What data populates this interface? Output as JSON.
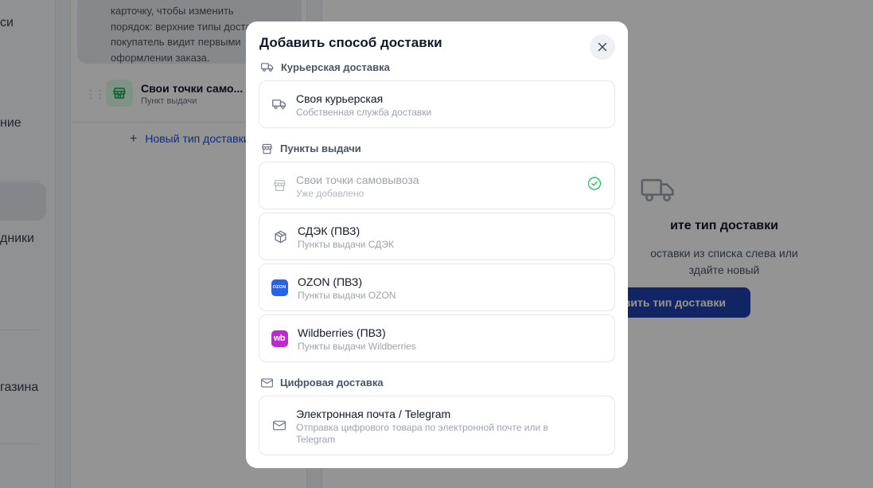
{
  "background": {
    "sidebar": {
      "items": [
        "си",
        "ние",
        "дники",
        "газина"
      ]
    },
    "list": {
      "hint_lines": [
        "карточку, чтобы изменить",
        "порядок: верхние типы доставки",
        "покупатель видит первыми",
        "оформлении заказа."
      ],
      "row_title": "Свои точки само...",
      "row_subtitle": "Пункт выдачи",
      "add_label": "Новый тип доставки",
      "add_icon": "plus-icon"
    },
    "main": {
      "empty_title": "ите тип доставки",
      "empty_desc_lines": [
        "оставки из списка слева или",
        "здайте новый"
      ],
      "empty_button": "авить тип доставки"
    }
  },
  "modal": {
    "title": "Добавить способ доставки",
    "close_icon": "close-icon",
    "sections": [
      {
        "label": "Курьерская доставка",
        "icon": "truck-icon",
        "options": [
          {
            "title": "Своя курьерская",
            "subtitle": "Собственная служба доставки",
            "icon": "truck-icon",
            "disabled": false
          }
        ]
      },
      {
        "label": "Пункты выдачи",
        "icon": "store-icon",
        "options": [
          {
            "title": "Свои точки самовывоза",
            "subtitle": "Уже добавлено",
            "icon": "store-icon",
            "disabled": true,
            "status_icon": "check-circle-icon"
          },
          {
            "title": "СДЭК (ПВЗ)",
            "subtitle": "Пункты выдачи СДЭК",
            "icon": "package-icon",
            "disabled": false
          },
          {
            "title": "OZON (ПВЗ)",
            "subtitle": "Пункты выдачи OZON",
            "icon": "ozon-logo-icon",
            "logo_text": "OZON",
            "disabled": false
          },
          {
            "title": "Wildberries (ПВЗ)",
            "subtitle": "Пункты выдачи Wildberries",
            "icon": "wildberries-logo-icon",
            "logo_text": "wb",
            "disabled": false
          }
        ]
      },
      {
        "label": "Цифровая доставка",
        "icon": "mail-icon",
        "options": [
          {
            "title": "Электронная почта / Telegram",
            "subtitle_lines": [
              "Отправка цифрового товара по электронной почте или в",
              "Telegram"
            ],
            "icon": "mail-icon",
            "disabled": false
          }
        ]
      }
    ]
  },
  "colors": {
    "accent": "#1e40af",
    "success": "#22c55e",
    "ozon": "#2563eb",
    "wildberries": "#c026d3"
  }
}
